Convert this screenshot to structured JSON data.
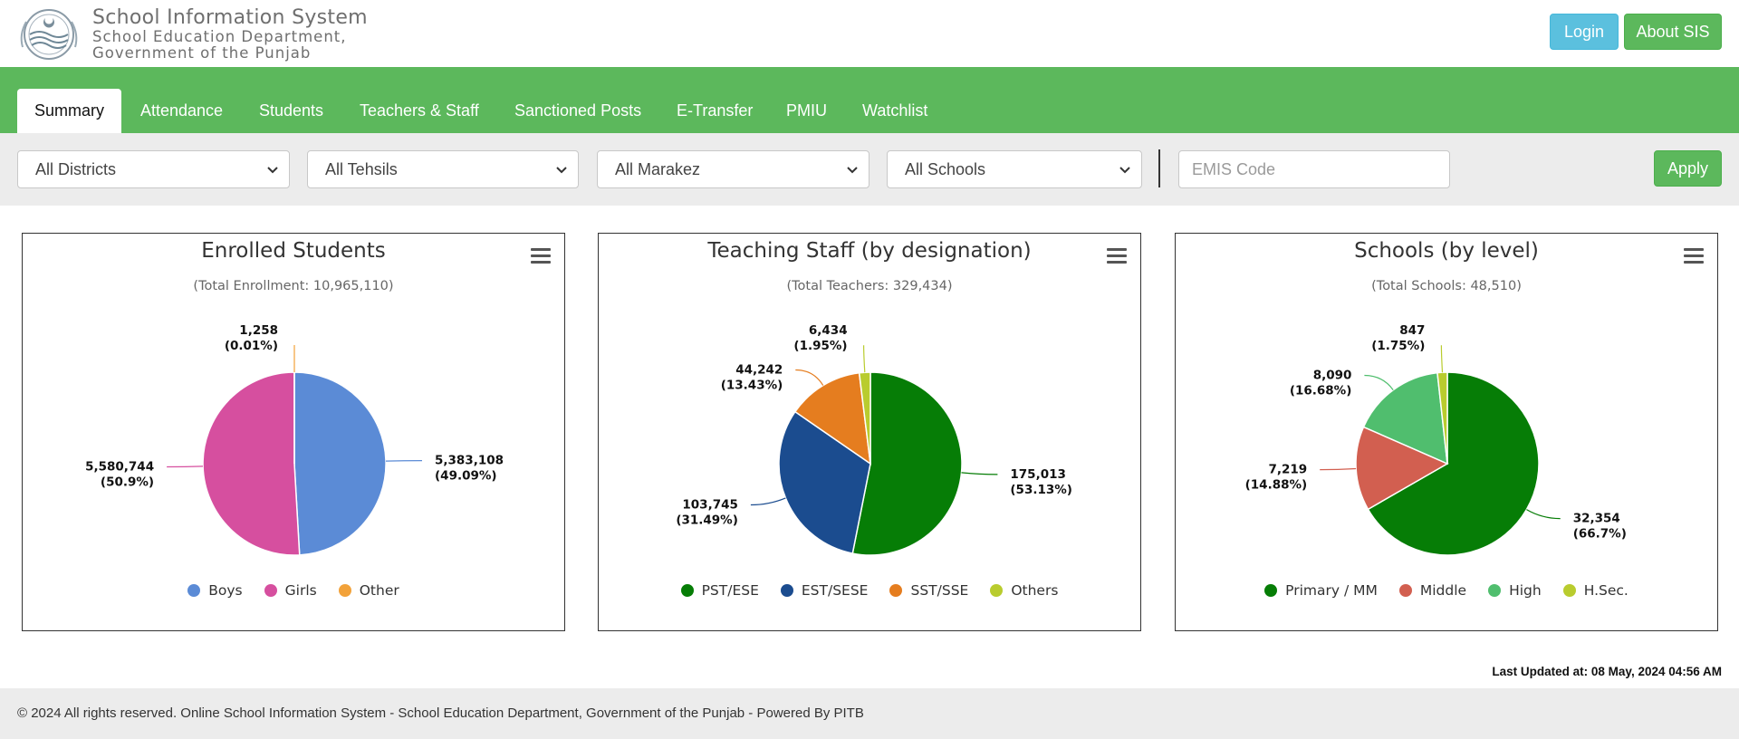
{
  "header": {
    "title": "School Information System",
    "subtitle1": "School Education Department,",
    "subtitle2": "Government of the Punjab",
    "login_label": "Login",
    "about_label": "About SIS"
  },
  "nav": {
    "tabs": [
      {
        "label": "Summary",
        "active": true
      },
      {
        "label": "Attendance"
      },
      {
        "label": "Students"
      },
      {
        "label": "Teachers & Staff"
      },
      {
        "label": "Sanctioned Posts"
      },
      {
        "label": "E-Transfer"
      },
      {
        "label": "PMIU"
      },
      {
        "label": "Watchlist"
      }
    ]
  },
  "filters": {
    "district": "All Districts",
    "tehsil": "All Tehsils",
    "markaz": "All Marakez",
    "school": "All Schools",
    "emis_placeholder": "EMIS Code",
    "apply_label": "Apply"
  },
  "chart_data": [
    {
      "type": "pie",
      "title": "Enrolled Students",
      "subtitle": "(Total Enrollment: 10,965,110)",
      "labels": [
        "Boys",
        "Girls",
        "Other"
      ],
      "values": [
        5383108,
        5580744,
        1258
      ],
      "display_values": [
        "5,383,108",
        "5,580,744",
        "1,258"
      ],
      "percent_labels": [
        "(49.09%)",
        "(50.9%)",
        "(0.01%)"
      ],
      "colors": [
        "#5b8bd6",
        "#d64f9f",
        "#f2a23a"
      ],
      "legend": "bottom"
    },
    {
      "type": "pie",
      "title": "Teaching Staff (by designation)",
      "subtitle": "(Total Teachers: 329,434)",
      "labels": [
        "PST/ESE",
        "EST/SESE",
        "SST/SSE",
        "Others"
      ],
      "values": [
        175013,
        103745,
        44242,
        6434
      ],
      "display_values": [
        "175,013",
        "103,745",
        "44,242",
        "6,434"
      ],
      "percent_labels": [
        "(53.13%)",
        "(31.49%)",
        "(13.43%)",
        "(1.95%)"
      ],
      "colors": [
        "#067d06",
        "#1b4c8f",
        "#e57d1f",
        "#b9cc2e"
      ],
      "legend": "bottom"
    },
    {
      "type": "pie",
      "title": "Schools (by level)",
      "subtitle": "(Total Schools: 48,510)",
      "labels": [
        "Primary / MM",
        "Middle",
        "High",
        "H.Sec."
      ],
      "values": [
        32354,
        7219,
        8090,
        847
      ],
      "display_values": [
        "32,354",
        "7,219",
        "8,090",
        "847"
      ],
      "percent_labels": [
        "(66.7%)",
        "(14.88%)",
        "(16.68%)",
        "(1.75%)"
      ],
      "colors": [
        "#067d06",
        "#d25f50",
        "#50be6e",
        "#b9cc2e"
      ],
      "legend": "bottom"
    }
  ],
  "status": {
    "last_updated": "Last Updated at: 08 May, 2024 04:56 AM"
  },
  "footer": {
    "text": "© 2024 All rights reserved. Online School Information System - School Education Department, Government of the Punjab - Powered By PITB"
  }
}
